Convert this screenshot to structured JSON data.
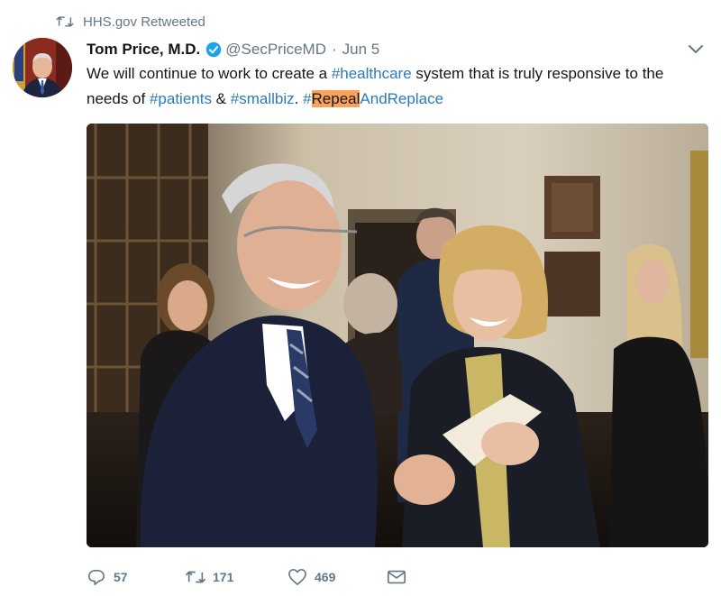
{
  "retweet": {
    "icon": "retweet-icon",
    "label": "HHS.gov Retweeted"
  },
  "author": {
    "name": "Tom Price, M.D.",
    "verified": true,
    "handle": "@SecPriceMD",
    "date": "Jun 5"
  },
  "tweet": {
    "t1": "We will continue to work to create a ",
    "tag1": "#healthcare",
    "t2": " system that is truly responsive to the needs of ",
    "tag2": "#patients",
    "t3": " & ",
    "tag3": "#smallbiz",
    "t4": ". ",
    "tag4_hash": "#",
    "tag4_highlight": "Repeal",
    "tag4_rest": "AndReplace"
  },
  "actions": {
    "reply_count": "57",
    "retweet_count": "171",
    "like_count": "469"
  },
  "colors": {
    "link": "#2b7bb9",
    "muted": "#657786",
    "highlight": "#f9a35a",
    "verified": "#1da1f2"
  }
}
